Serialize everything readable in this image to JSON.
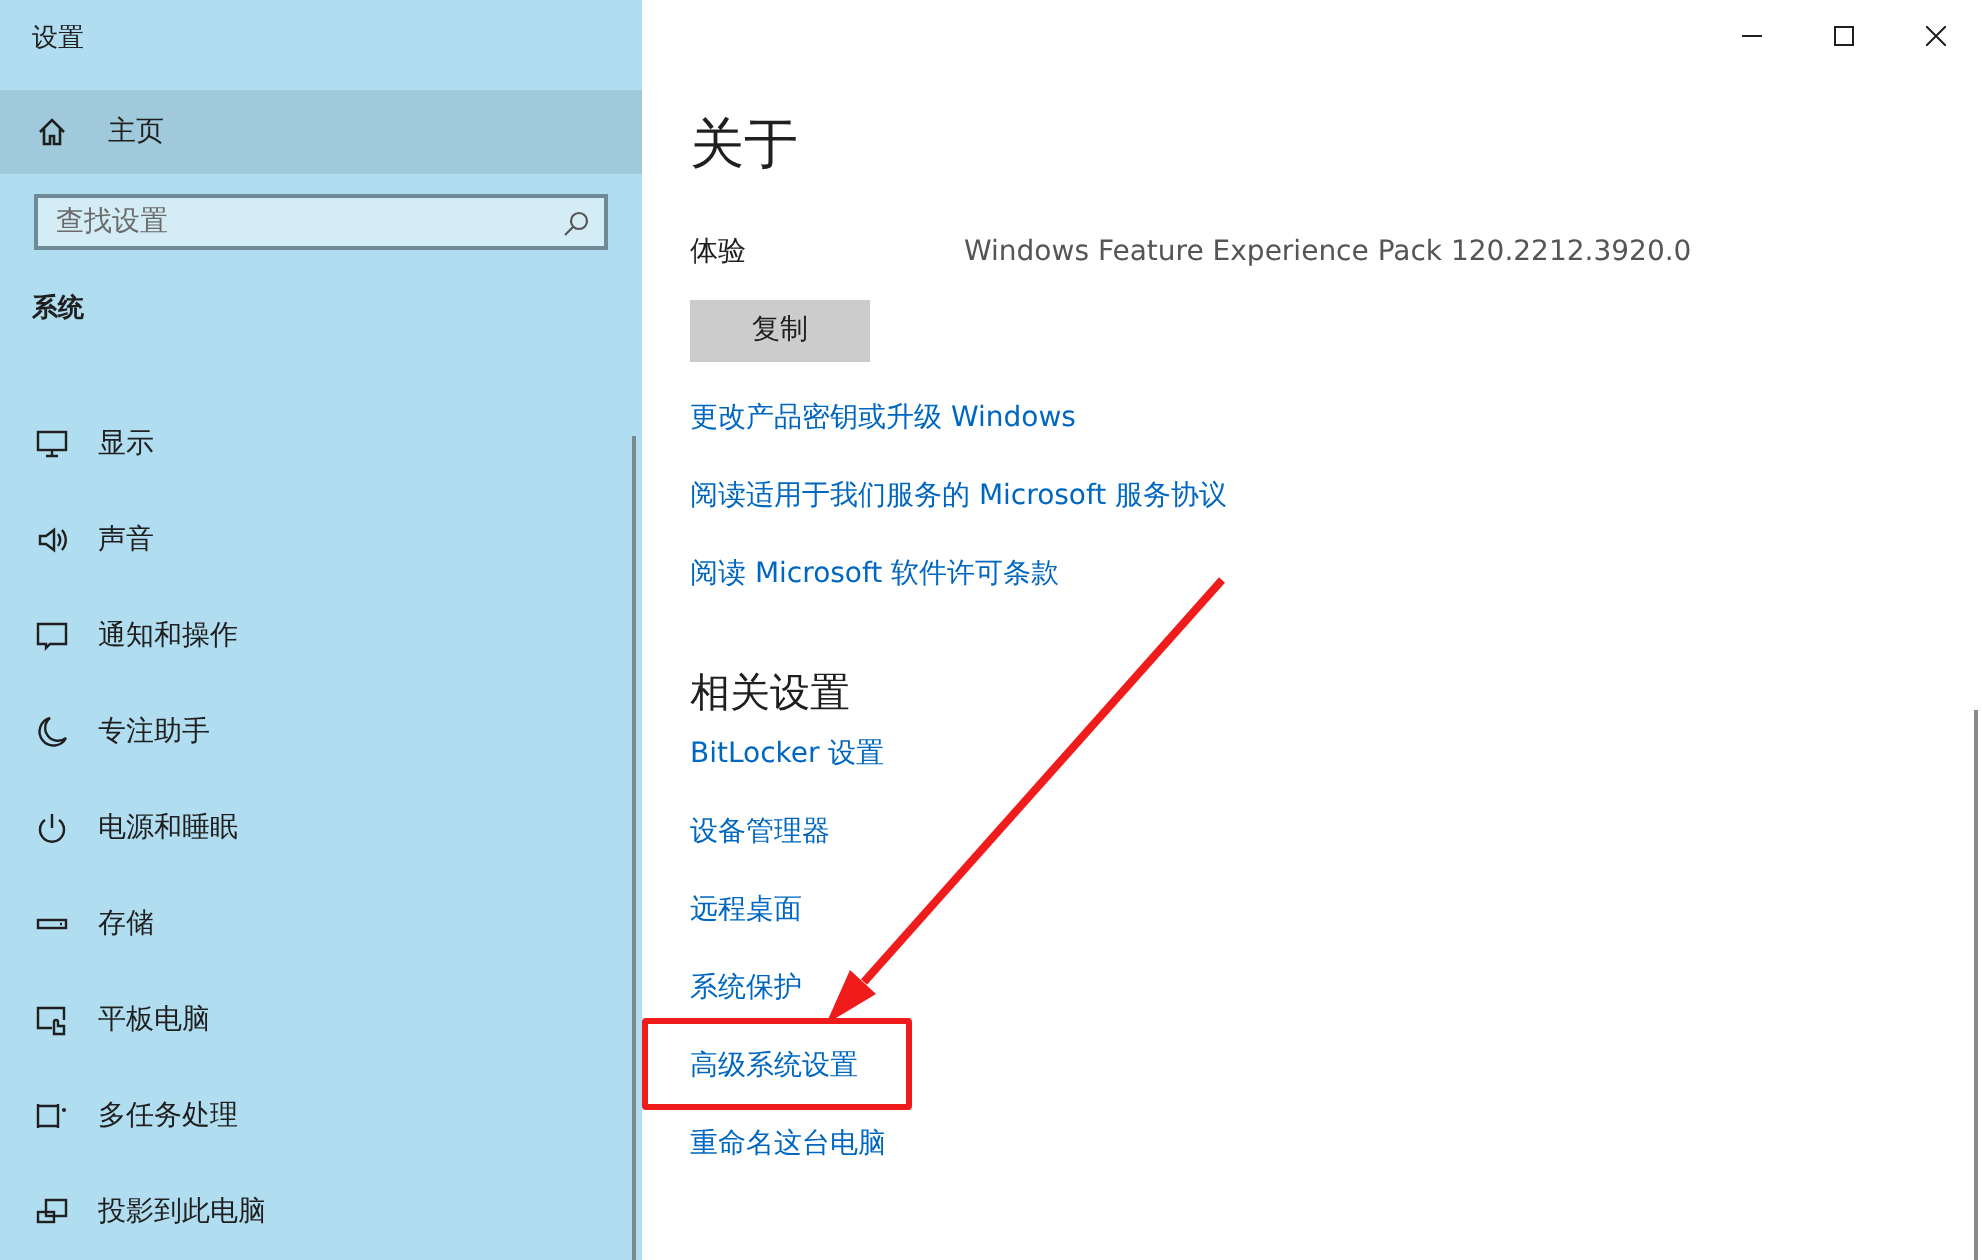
{
  "window": {
    "title": "设置"
  },
  "sidebar": {
    "home": {
      "label": "主页",
      "selected": false
    },
    "search": {
      "placeholder": "查找设置"
    },
    "section": "系统",
    "items": [
      {
        "label": "显示",
        "kind": "display"
      },
      {
        "label": "声音",
        "kind": "sound"
      },
      {
        "label": "通知和操作",
        "kind": "notification"
      },
      {
        "label": "专注助手",
        "kind": "moon"
      },
      {
        "label": "电源和睡眠",
        "kind": "power"
      },
      {
        "label": "存储",
        "kind": "storage"
      },
      {
        "label": "平板电脑",
        "kind": "tablet"
      },
      {
        "label": "多任务处理",
        "kind": "multitask"
      },
      {
        "label": "投影到此电脑",
        "kind": "project"
      }
    ]
  },
  "content": {
    "title": "关于",
    "specs": [
      {
        "label": "体验",
        "value": "Windows Feature Experience Pack 120.2212.3920.0"
      }
    ],
    "copy_button": "复制",
    "links": [
      "更改产品密钥或升级 Windows",
      "阅读适用于我们服务的 Microsoft 服务协议",
      "阅读 Microsoft 软件许可条款"
    ],
    "related": {
      "title": "相关设置",
      "links": [
        {
          "label": "BitLocker 设置",
          "highlighted": false
        },
        {
          "label": "设备管理器",
          "highlighted": false
        },
        {
          "label": "远程桌面",
          "highlighted": false
        },
        {
          "label": "系统保护",
          "highlighted": false
        },
        {
          "label": "高级系统设置",
          "highlighted": true
        },
        {
          "label": "重命名这台电脑",
          "highlighted": false
        }
      ]
    }
  }
}
